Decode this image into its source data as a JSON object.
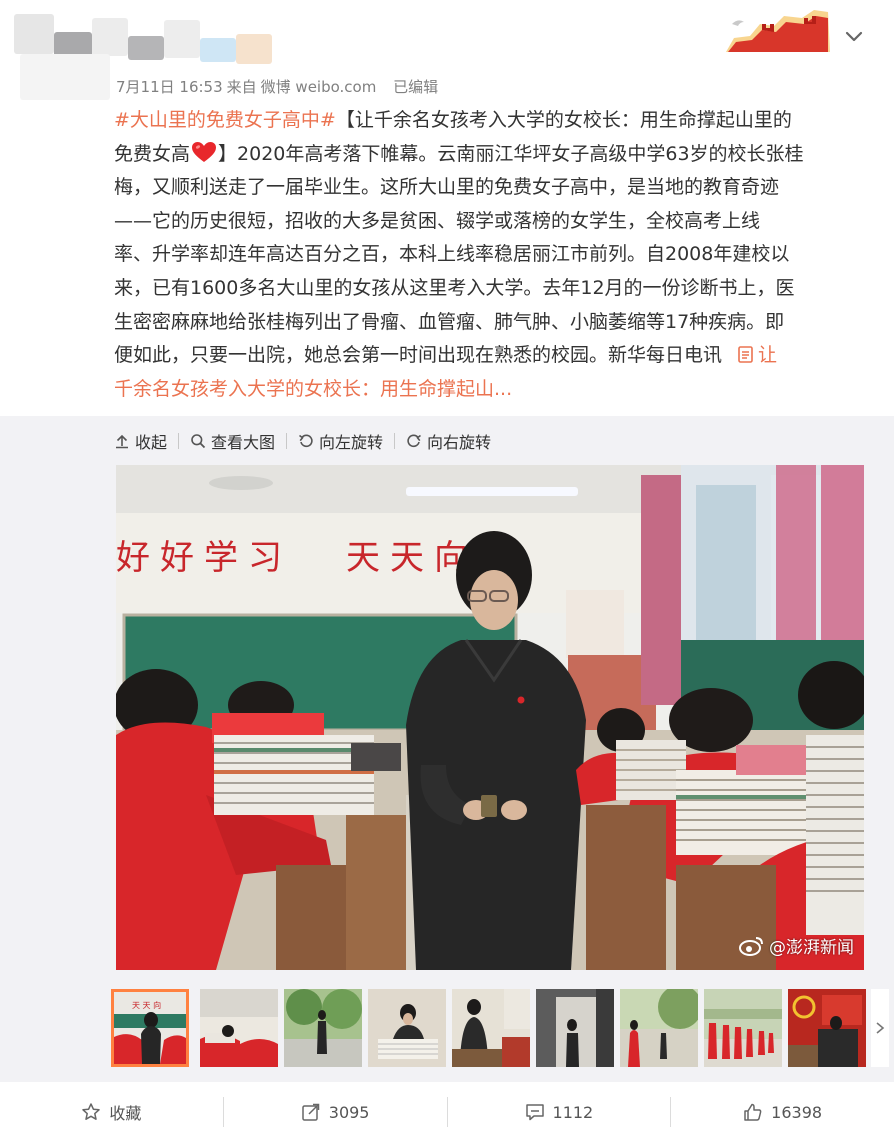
{
  "post": {
    "meta": {
      "date": "7月11日 16:53",
      "source_prefix": "来自",
      "source_name": "微博 weibo.com",
      "edited": "已编辑"
    },
    "text_lines": [
      {
        "tag": "#大山里的免费女子高中#",
        "text": "【让千余名女孩考入大学的女校长：用生命撑起山里的"
      },
      {
        "text_a": "免费女高",
        "text_b": "】2020年高考落下帷幕。云南丽江华坪女子高级中学63岁的校长张桂"
      },
      {
        "text": "梅，又顺利送走了一届毕业生。这所大山里的免费女子高中，是当地的教育奇迹"
      },
      {
        "text": "——它的历史很短，招收的大多是贫困、辍学或落榜的女学生，全校高考上线"
      },
      {
        "text": "率、升学率却连年高达百分之百，本科上线率稳居丽江市前列。自2008年建校以"
      },
      {
        "text": "来，已有1600多名大山里的女孩从这里考入大学。去年12月的一份诊断书上，医"
      },
      {
        "text": "生密密麻麻地给张桂梅列出了骨瘤、血管瘤、肺气肿、小脑萎缩等17种疾病。即"
      },
      {
        "text": "便如此，只要一出院，她总会第一时间出现在熟悉的校园。新华每日电讯",
        "link": "让"
      },
      {
        "link": "千余名女孩考入大学的女校长：用生命撑起山..."
      }
    ]
  },
  "media": {
    "toolbar": {
      "collapse": "收起",
      "view_large": "查看大图",
      "rotate_left": "向左旋转",
      "rotate_right": "向右旋转"
    },
    "photo": {
      "banner_left": "好好学习",
      "banner_right": "天天向上",
      "watermark": "@澎湃新闻"
    },
    "thumb_banner": "天 天 向"
  },
  "footer": {
    "favorite": "收藏",
    "repost_count": "3095",
    "comment_count": "1112",
    "like_count": "16398"
  },
  "colors": {
    "accent": "#eb7350",
    "thumb_active": "#ff8140",
    "panel_bg": "#f2f2f5",
    "uniform_red": "#d8262a"
  }
}
